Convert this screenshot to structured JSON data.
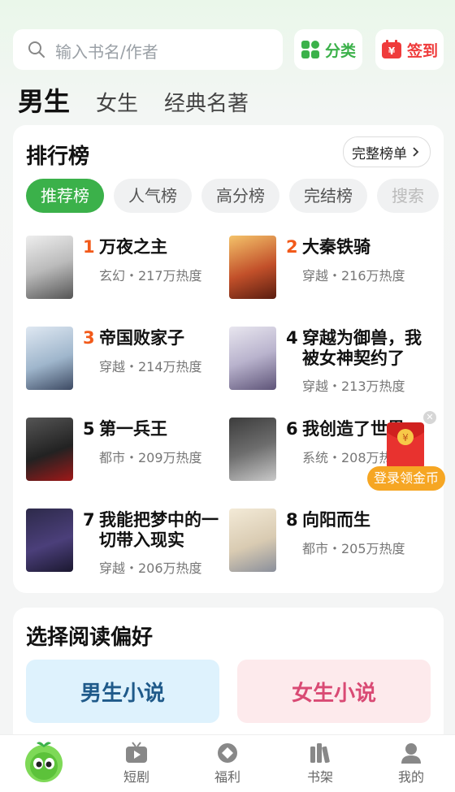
{
  "search": {
    "placeholder": "输入书名/作者"
  },
  "top_buttons": {
    "category": "分类",
    "signin": "签到"
  },
  "gender_tabs": [
    "男生",
    "女生",
    "经典名著"
  ],
  "ranking": {
    "title": "排行榜",
    "full_list": "完整榜单",
    "chips": [
      "推荐榜",
      "人气榜",
      "高分榜",
      "完结榜",
      "搜索"
    ],
    "books": [
      {
        "rank": "1",
        "title": "万夜之主",
        "meta": "玄幻・217万热度"
      },
      {
        "rank": "2",
        "title": "大秦铁骑",
        "meta": "穿越・216万热度"
      },
      {
        "rank": "3",
        "title": "帝国败家子",
        "meta": "穿越・214万热度"
      },
      {
        "rank": "4",
        "title": "穿越为御兽，我被女神契约了",
        "meta": "穿越・213万热度"
      },
      {
        "rank": "5",
        "title": "第一兵王",
        "meta": "都市・209万热度"
      },
      {
        "rank": "6",
        "title": "我创造了世界",
        "meta": "系统・208万热度"
      },
      {
        "rank": "7",
        "title": "我能把梦中的一切带入现实",
        "meta": "穿越・206万热度"
      },
      {
        "rank": "8",
        "title": "向阳而生",
        "meta": "都市・205万热度"
      }
    ]
  },
  "preference": {
    "title": "选择阅读偏好",
    "male": "男生小说",
    "female": "女生小说"
  },
  "floating": {
    "label": "登录领金币"
  },
  "nav": [
    "短剧",
    "福利",
    "书架",
    "我的"
  ],
  "colors": {
    "accent": "#3bb14a",
    "rank_hot": "#f25a1a",
    "signin_red": "#ef3b3b"
  }
}
